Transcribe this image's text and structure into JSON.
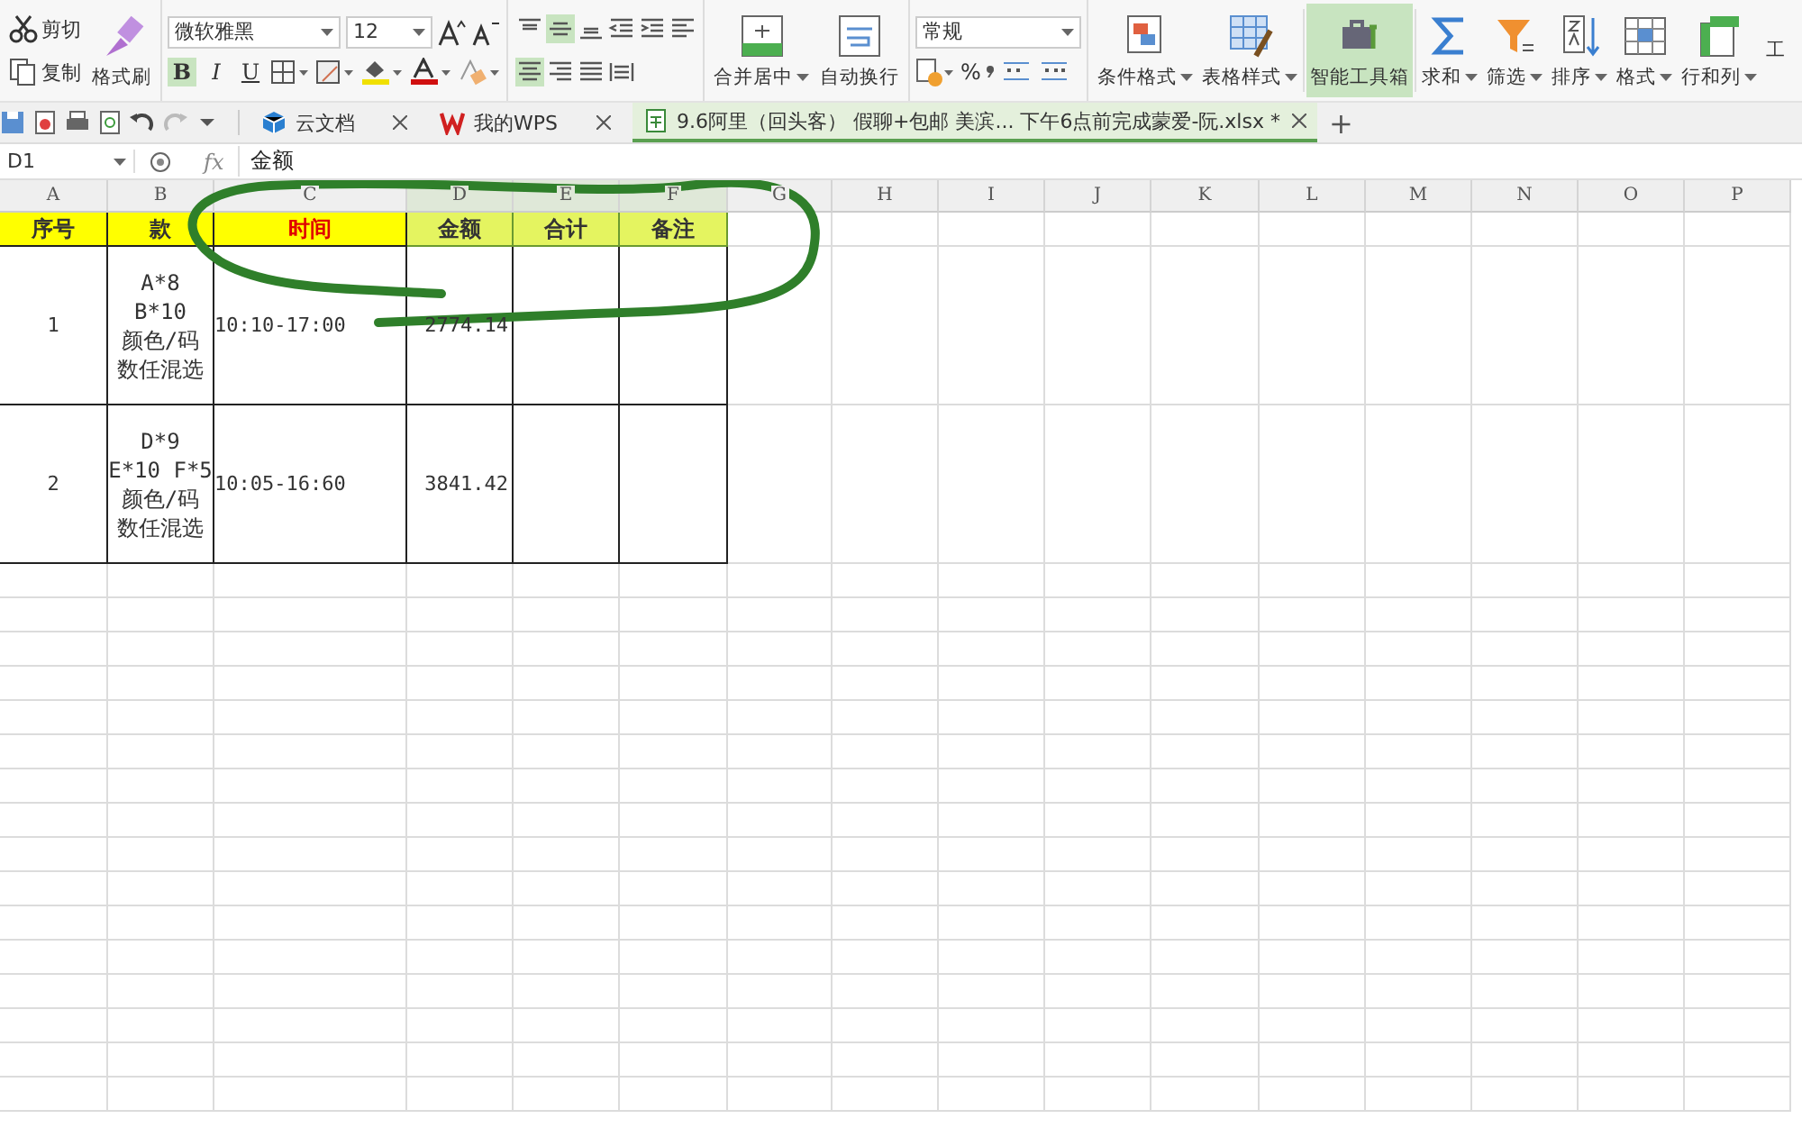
{
  "ribbon": {
    "clipboard": [
      {
        "label": "剪切",
        "kind": "cut"
      },
      {
        "label": "复制",
        "kind": "copy"
      },
      {
        "label": "格式刷",
        "kind": "brush"
      }
    ],
    "font": {
      "name": "微软雅黑",
      "size": "12"
    },
    "styles": [
      {
        "label": "B",
        "selected": true
      },
      {
        "label": "I",
        "selected": false
      },
      {
        "label": "U",
        "selected": false
      }
    ],
    "alignment": [
      {
        "kind": "top",
        "selected": false
      },
      {
        "kind": "middle",
        "selected": true
      },
      {
        "kind": "bottom",
        "selected": false
      },
      {
        "kind": "left",
        "selected": false
      },
      {
        "kind": "center",
        "selected": true
      },
      {
        "kind": "right",
        "selected": false
      }
    ],
    "big_buttons": [
      {
        "label": "合并居中",
        "kind": "merge",
        "dropdown": true
      },
      {
        "label": "自动换行",
        "kind": "wrap",
        "dropdown": false
      }
    ],
    "number_format": "常规",
    "percent": "%",
    "tool_buttons": [
      {
        "label": "条件格式",
        "kind": "cond",
        "dropdown": true,
        "selected": false
      },
      {
        "label": "表格样式",
        "kind": "table",
        "dropdown": true,
        "selected": false
      },
      {
        "label": "智能工具箱",
        "kind": "toolbox",
        "dropdown": false,
        "selected": true
      },
      {
        "label": "求和",
        "kind": "sum",
        "dropdown": true,
        "selected": false
      },
      {
        "label": "筛选",
        "kind": "filter",
        "dropdown": true,
        "selected": false
      },
      {
        "label": "排序",
        "kind": "sort",
        "dropdown": true,
        "selected": false
      },
      {
        "label": "格式",
        "kind": "format",
        "dropdown": true,
        "selected": false
      },
      {
        "label": "行和列",
        "kind": "rowcol",
        "dropdown": true,
        "selected": false
      },
      {
        "label": "工",
        "kind": "partial",
        "dropdown": false,
        "selected": false
      }
    ]
  },
  "tabs": [
    {
      "label": "云文档",
      "kind": "cloud",
      "selected": false
    },
    {
      "label": "我的WPS",
      "kind": "wps",
      "selected": false
    },
    {
      "label": "9.6阿里（回头客） 假聊+包邮 美滨... 下午6点前完成蒙爱-阮.xlsx *",
      "kind": "sheet",
      "selected": true
    }
  ],
  "new_tab": "+",
  "formula_bar": {
    "cell_ref": "D1",
    "fx": "fx",
    "value": "金额"
  },
  "sheet": {
    "columns": [
      {
        "label": "A",
        "selected": false
      },
      {
        "label": "B",
        "selected": false
      },
      {
        "label": "C",
        "selected": false
      },
      {
        "label": "D",
        "selected": true
      },
      {
        "label": "E",
        "selected": true
      },
      {
        "label": "F",
        "selected": true
      },
      {
        "label": "G",
        "selected": false
      },
      {
        "label": "H",
        "selected": false
      },
      {
        "label": "I",
        "selected": false
      },
      {
        "label": "J",
        "selected": false
      },
      {
        "label": "K",
        "selected": false
      },
      {
        "label": "L",
        "selected": false
      },
      {
        "label": "M",
        "selected": false
      },
      {
        "label": "N",
        "selected": false
      },
      {
        "label": "O",
        "selected": false
      },
      {
        "label": "P",
        "selected": false
      }
    ],
    "header": [
      {
        "text": "序号",
        "emphasis": false,
        "selected": false
      },
      {
        "text": "款",
        "emphasis": false,
        "selected": false
      },
      {
        "text": "时间",
        "emphasis": true,
        "selected": false
      },
      {
        "text": "金额",
        "emphasis": false,
        "selected": true
      },
      {
        "text": "合计",
        "emphasis": false,
        "selected": true
      },
      {
        "text": "备注",
        "emphasis": false,
        "selected": true
      }
    ],
    "rows": [
      [
        "1",
        "A*8\nB*10\n颜色/码数任混选",
        "10:10-17:00",
        "2774.14",
        "",
        ""
      ],
      [
        "2",
        "D*9\nE*10 F*5\n颜色/码数任混选",
        "10:05-16:60",
        "3841.42",
        "",
        ""
      ]
    ]
  }
}
